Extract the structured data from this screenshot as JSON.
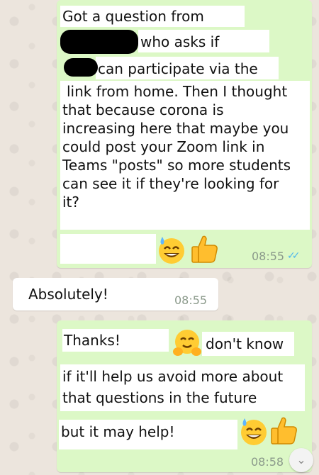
{
  "messages": {
    "first": {
      "lines": [
        "Got a question from",
        "who asks if",
        "can participate via the",
        "link from home. Then I thought",
        "that because corona is",
        "increasing here that maybe you",
        "could post your Zoom link in",
        "Teams \"posts\" so more students",
        "can see it if they're looking for",
        "it?"
      ],
      "time": "08:55",
      "status_icon": "double-check-read"
    },
    "reply": {
      "text": "Absolutely!",
      "time": "08:55"
    },
    "second": {
      "lines": [
        "Thanks!",
        "don't know",
        "if it'll help us avoid more about",
        "that questions in the future",
        "but it may help!"
      ],
      "time": "08:58"
    }
  },
  "colors": {
    "outgoing": "#dcf8c6",
    "incoming": "#ffffff",
    "read_ticks": "#4fb6ec",
    "background": "#ece5dd"
  },
  "icons": [
    "sweat-smile-emoji",
    "thumbs-up-emoji",
    "hugging-emoji",
    "chevron-down-icon"
  ]
}
